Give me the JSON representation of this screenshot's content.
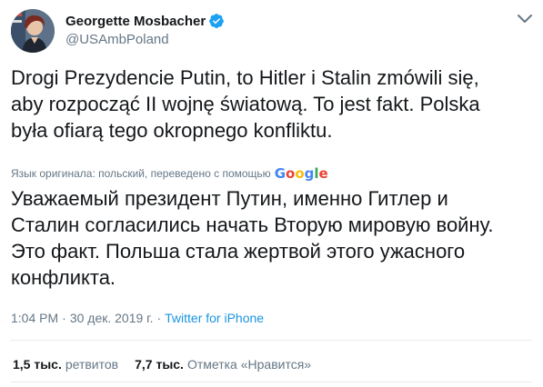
{
  "author": {
    "display_name": "Georgette Mosbacher",
    "handle": "@USAmbPoland",
    "verified": true,
    "verified_color": "#1da1f2"
  },
  "tweet": {
    "text_lines": [
      "Drogi Prezydencie Putin, to Hitler i Stalin zmówili się,",
      "aby rozpocząć II wojnę światową. To jest fakt. Polska",
      "była ofiarą tego okropnego konfliktu."
    ]
  },
  "translation": {
    "meta_label": "Язык оригинала: польский, переведено с помощью",
    "provider": "Google",
    "text_lines": [
      "Уважаемый президент Путин, именно Гитлер и",
      "Сталин согласились начать Вторую мировую войну.",
      "Это факт. Польша стала жертвой этого ужасного",
      "конфликта."
    ]
  },
  "meta": {
    "time": "1:04 PM",
    "separator": "·",
    "date": "30 дек. 2019 г.",
    "source": "Twitter for iPhone"
  },
  "stats": {
    "retweets_count": "1,5 тыс.",
    "retweets_label": "ретвитов",
    "likes_count": "7,7 тыс.",
    "likes_label": "Отметка «Нравится»"
  },
  "icons": {
    "verified": "verified-badge-icon",
    "more": "chevron-down-icon"
  },
  "colors": {
    "text": "#14171a",
    "secondary": "#657786",
    "link": "#1b95e0"
  }
}
